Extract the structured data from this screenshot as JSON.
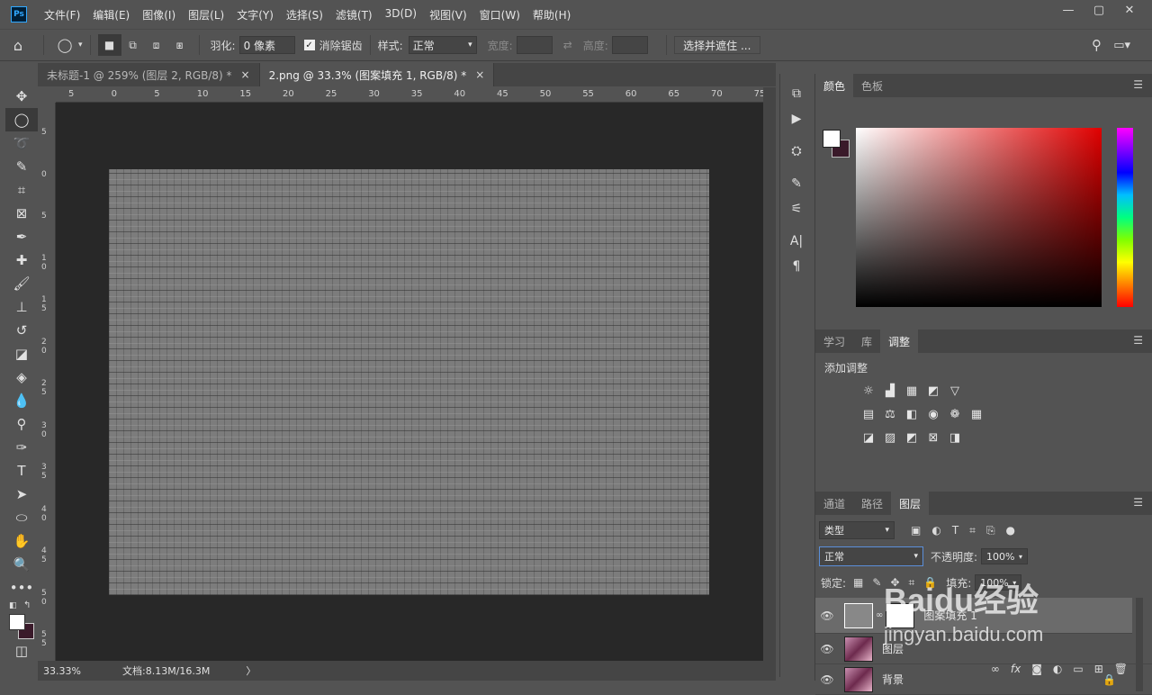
{
  "app": {
    "logo": "Ps"
  },
  "menu": [
    "文件(F)",
    "编辑(E)",
    "图像(I)",
    "图层(L)",
    "文字(Y)",
    "选择(S)",
    "滤镜(T)",
    "3D(D)",
    "视图(V)",
    "窗口(W)",
    "帮助(H)"
  ],
  "window_controls": [
    "—",
    "▢",
    "✕"
  ],
  "options": {
    "feather_label": "羽化:",
    "feather_value": "0 像素",
    "antialias_label": "消除锯齿",
    "style_label": "样式:",
    "style_value": "正常",
    "width_label": "宽度:",
    "height_label": "高度:",
    "select_mask_button": "选择并遮住 ..."
  },
  "tabs": [
    {
      "label": "未标题-1 @ 259% (图层 2, RGB/8) *",
      "close": "×"
    },
    {
      "label": "2.png @ 33.3% (图案填充 1, RGB/8) *",
      "close": "×"
    }
  ],
  "ruler_top_labels": [
    "5",
    "0",
    "5",
    "10",
    "15",
    "20",
    "25",
    "30",
    "35",
    "40",
    "45",
    "50",
    "55",
    "60",
    "65",
    "70",
    "75"
  ],
  "ruler_left_labels": [
    "5",
    "0",
    "5",
    "1 0",
    "1 5",
    "2 0",
    "2 5",
    "3 0",
    "3 5",
    "4 0",
    "4 5",
    "5 0",
    "5 5"
  ],
  "status": {
    "zoom": "33.33%",
    "doc_info": "文档:8.13M/16.3M",
    "arrow": "〉"
  },
  "color_panel": {
    "tabs": [
      "颜色",
      "色板"
    ],
    "fg": "#ffffff",
    "bg": "#3a1a2a"
  },
  "adjust_panel": {
    "tabs": [
      "学习",
      "库",
      "调整"
    ],
    "title": "添加调整"
  },
  "layers_panel": {
    "tabs": [
      "通道",
      "路径",
      "图层"
    ],
    "filter_label": "类型",
    "blend_mode": "正常",
    "opacity_label": "不透明度:",
    "opacity_value": "100%",
    "lock_label": "锁定:",
    "fill_label": "填充:",
    "fill_value": "100%",
    "layers": [
      {
        "name": "图案填充 1"
      },
      {
        "name": "图层"
      },
      {
        "name": "背景"
      }
    ]
  },
  "watermark": {
    "text": "Baidu经验",
    "url": "jingyan.baidu.com"
  }
}
